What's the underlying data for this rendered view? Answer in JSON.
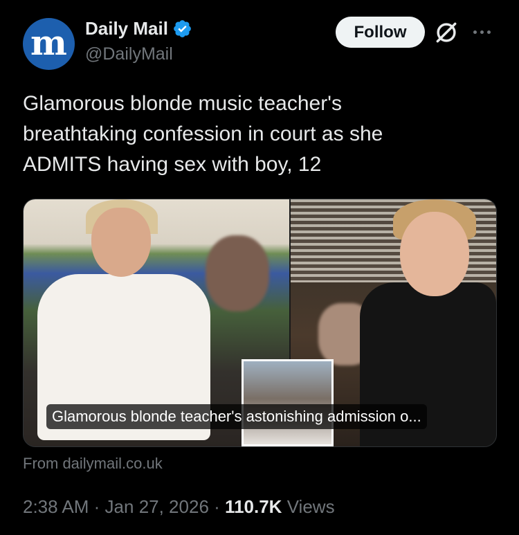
{
  "author": {
    "avatar_glyph": "m",
    "display_name": "Daily Mail",
    "handle": "@DailyMail",
    "verified_color": "#1d9bf0"
  },
  "actions": {
    "follow_label": "Follow",
    "grok_icon": "grok-icon",
    "more_icon": "more-icon"
  },
  "tweet": {
    "text_line1": "Glamorous blonde music teacher's",
    "text_line2": "breathtaking confession in court as she",
    "text_line3": "ADMITS having sex with boy, 12"
  },
  "card": {
    "caption": "Glamorous blonde teacher's astonishing admission o...",
    "source": "From dailymail.co.uk"
  },
  "meta": {
    "time": "2:38 AM",
    "separator": "·",
    "date": "Jan 27, 2026",
    "views_count": "110.7K",
    "views_label": "Views"
  },
  "colors": {
    "background": "#000000",
    "primary_text": "#e7e9ea",
    "secondary_text": "#71767b",
    "avatar_bg": "#1d5fae"
  }
}
